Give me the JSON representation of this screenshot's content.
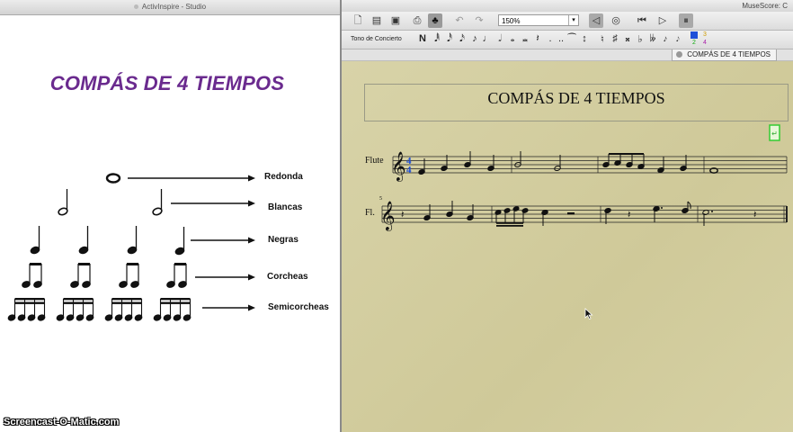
{
  "left_window": {
    "title": "ActivInspire - Studio",
    "slide_title": "COMPÁS DE 4 TIEMPOS",
    "labels": {
      "redonda": "Redonda",
      "blancas": "Blancas",
      "negras": "Negras",
      "corcheas": "Corcheas",
      "semicorcheas": "Semicorcheas"
    },
    "watermark": "Screencast-O-Matic.com"
  },
  "right_window": {
    "title": "MuseScore: C",
    "zoom_value": "150%",
    "concert_pitch": "Tono de Concierto",
    "note_input_label": "N",
    "voice_numbers": [
      "1",
      "2",
      "3",
      "4"
    ],
    "tab_label": "COMPÁS DE 4 TIEMPOS",
    "score_title": "COMPÁS DE 4 TIEMPOS",
    "instrument_full": "Flute",
    "instrument_short": "Fl.",
    "time_signature_top": "4",
    "measure_number": "5",
    "colors": {
      "canvas": "#d4cea1",
      "slide_title": "#6a2a8e",
      "selection": "#1a4bd6",
      "frame_marker": "#33cc33"
    }
  }
}
